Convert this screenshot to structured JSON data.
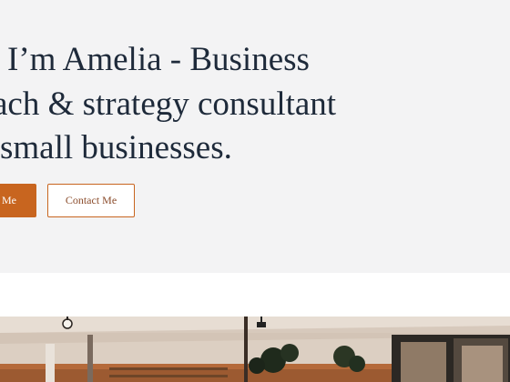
{
  "hero": {
    "headline_lines": [
      "I’m Amelia - Business",
      "ach & strategy consultant",
      "small businesses."
    ]
  },
  "buttons": {
    "primary_label": "t Me",
    "secondary_label": "Contact Me"
  },
  "colors": {
    "hero_bg": "#f3f3f4",
    "text": "#1e2a3a",
    "accent": "#c8651f"
  },
  "photo": {
    "icon": "office-interior-photo"
  }
}
